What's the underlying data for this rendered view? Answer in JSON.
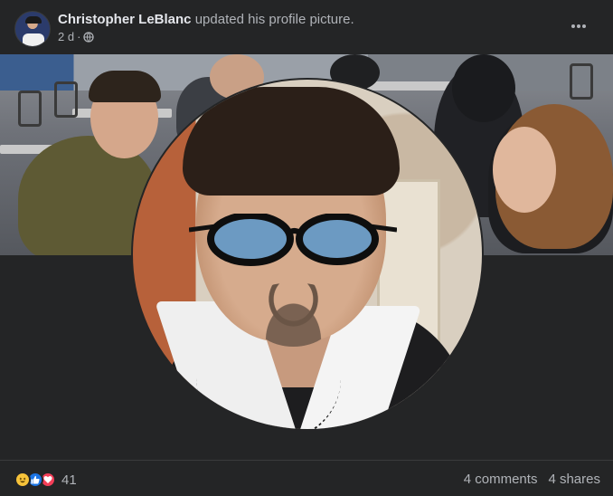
{
  "post": {
    "author": "Christopher LeBlanc",
    "action": "updated his profile picture.",
    "time": "2 d",
    "separator": "·",
    "privacy_icon": "globe-icon",
    "more_icon": "more-horizontal-icon"
  },
  "footer": {
    "reaction_icons": [
      "haha-icon",
      "like-icon",
      "love-icon"
    ],
    "reaction_count": "41",
    "comments": "4 comments",
    "shares": "4 shares"
  },
  "colors": {
    "background": "#242526",
    "text_primary": "#e4e6eb",
    "text_secondary": "#b0b3b8",
    "like_blue": "#1b74e4",
    "love_red": "#f33e58",
    "haha_yellow": "#f7c33a"
  }
}
